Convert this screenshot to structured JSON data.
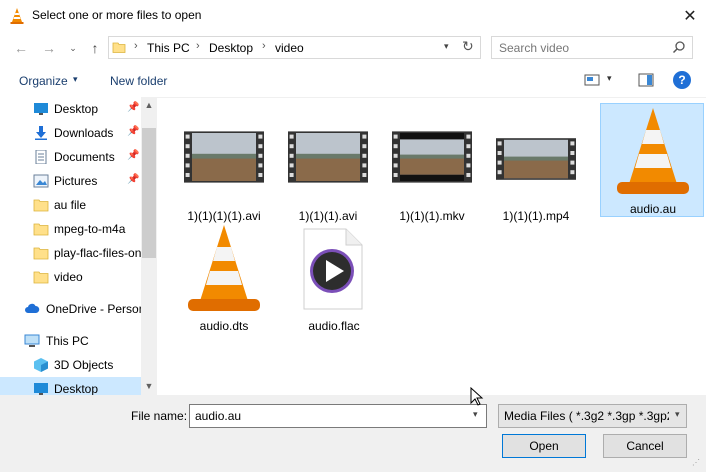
{
  "window": {
    "title": "Select one or more files to open"
  },
  "address": {
    "crumbs": [
      "This PC",
      "Desktop",
      "video"
    ]
  },
  "search": {
    "placeholder": "Search video"
  },
  "toolbar": {
    "organize_label": "Organize",
    "new_folder_label": "New folder"
  },
  "nav": {
    "items": [
      {
        "label": "Desktop",
        "icon": "desktop-icon",
        "pinned": true
      },
      {
        "label": "Downloads",
        "icon": "download-icon",
        "pinned": true
      },
      {
        "label": "Documents",
        "icon": "documents-icon",
        "pinned": true
      },
      {
        "label": "Pictures",
        "icon": "pictures-icon",
        "pinned": true
      },
      {
        "label": "au file",
        "icon": "folder-icon"
      },
      {
        "label": "mpeg-to-m4a",
        "icon": "folder-icon"
      },
      {
        "label": "play-flac-files-on",
        "icon": "folder-icon"
      },
      {
        "label": "video",
        "icon": "folder-icon"
      },
      {
        "label": "OneDrive - Person",
        "icon": "cloud-icon"
      },
      {
        "label": "This PC",
        "icon": "computer-icon"
      },
      {
        "label": "3D Objects",
        "icon": "3d-objects-icon"
      },
      {
        "label": "Desktop",
        "icon": "desktop-icon",
        "selected": true
      }
    ]
  },
  "files": [
    {
      "name": "1)(1)(1)(1).avi",
      "type": "video-thumbnail"
    },
    {
      "name": "1)(1)(1).avi",
      "type": "video-thumbnail"
    },
    {
      "name": "1)(1)(1).mkv",
      "type": "video-thumbnail"
    },
    {
      "name": "1)(1)(1).mp4",
      "type": "video-thumbnail"
    },
    {
      "name": "audio.au",
      "type": "vlc-cone-icon",
      "selected": true
    },
    {
      "name": "audio.dts",
      "type": "vlc-cone-icon"
    },
    {
      "name": "audio.flac",
      "type": "media-play-icon"
    }
  ],
  "bottom": {
    "file_name_label": "File name:",
    "file_name_value": "audio.au",
    "file_type": "Media Files ( *.3g2 *.3gp *.3gp2",
    "open_label": "Open",
    "cancel_label": "Cancel"
  },
  "colors": {
    "selection": "#cce8ff",
    "accent": "#0078d7",
    "vlc_orange": "#f28a00"
  }
}
